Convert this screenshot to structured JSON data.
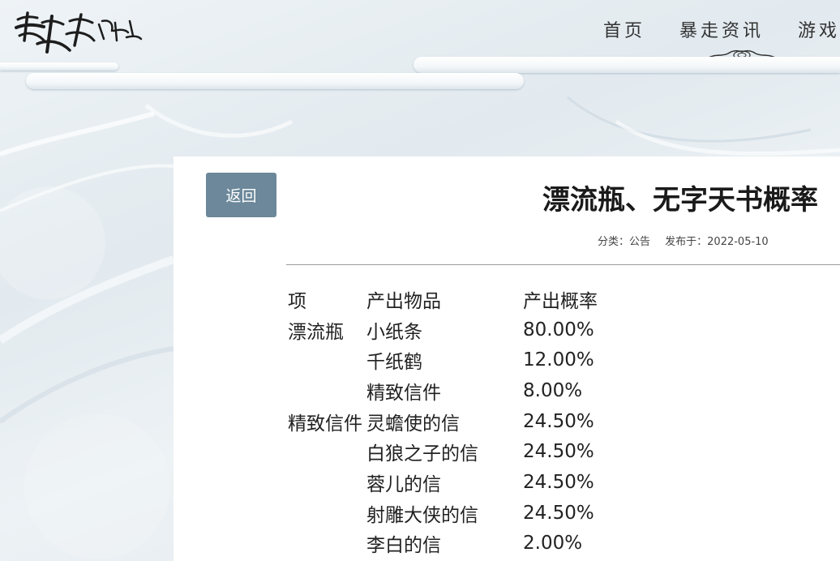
{
  "header": {
    "logo_text": "暴走英雄坛",
    "nav": [
      "首页",
      "暴走资讯",
      "游戏"
    ]
  },
  "article": {
    "back_label": "返回",
    "title": "漂流瓶、无字天书概率",
    "category": "分类：公告",
    "published": "发布于：2022-05-10",
    "table": {
      "headers": [
        "项",
        "产出物品",
        "产出概率"
      ],
      "rows": [
        [
          "漂流瓶",
          "小纸条",
          "80.00%"
        ],
        [
          "",
          "千纸鹤",
          "12.00%"
        ],
        [
          "",
          "精致信件",
          "8.00%"
        ],
        [
          "精致信件",
          "灵蟾使的信",
          "24.50%"
        ],
        [
          "",
          "白狼之子的信",
          "24.50%"
        ],
        [
          "",
          "蓉儿的信",
          "24.50%"
        ],
        [
          "",
          "射雕大侠的信",
          "24.50%"
        ],
        [
          "",
          "李白的信",
          "2.00%"
        ]
      ]
    }
  },
  "colors": {
    "back_button": "#6c889a",
    "card": "#ffffff",
    "background": "#e6edf1"
  }
}
